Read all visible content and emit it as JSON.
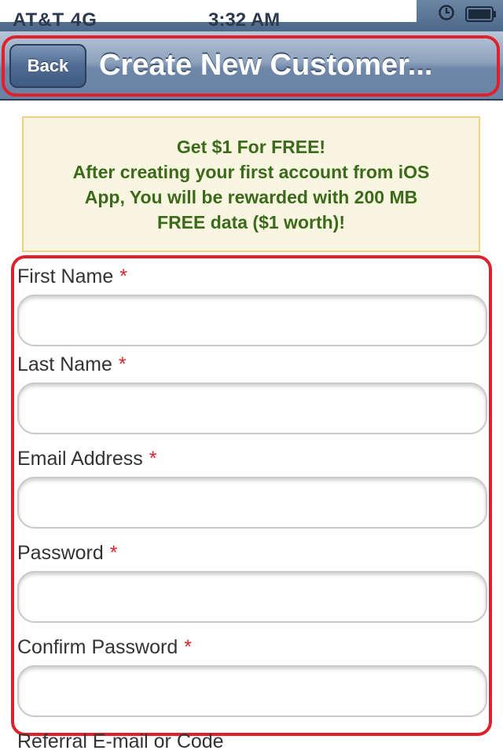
{
  "status_bar": {
    "carrier": "AT&T 4G",
    "time": "3:32 AM"
  },
  "nav": {
    "back_label": "Back",
    "title": "Create New Customer..."
  },
  "promo": {
    "line1": "Get $1 For FREE!",
    "line2": "After creating your first account from iOS",
    "line3": "App, You will be rewarded with 200 MB",
    "line4": "FREE data ($1 worth)!"
  },
  "form": {
    "required_mark": "*",
    "fields": [
      {
        "label": "First Name",
        "value": "",
        "placeholder": ""
      },
      {
        "label": "Last Name",
        "value": "",
        "placeholder": ""
      },
      {
        "label": "Email Address",
        "value": "",
        "placeholder": ""
      },
      {
        "label": "Password",
        "value": "",
        "placeholder": ""
      },
      {
        "label": "Confirm Password",
        "value": "",
        "placeholder": ""
      }
    ],
    "referral_label": "Referral E-mail or Code"
  },
  "colors": {
    "highlight": "#e0212b",
    "promo_text": "#3b6a1a",
    "nav_bar": "#6e87a8"
  },
  "icons": [
    "clock-icon",
    "battery-icon"
  ]
}
